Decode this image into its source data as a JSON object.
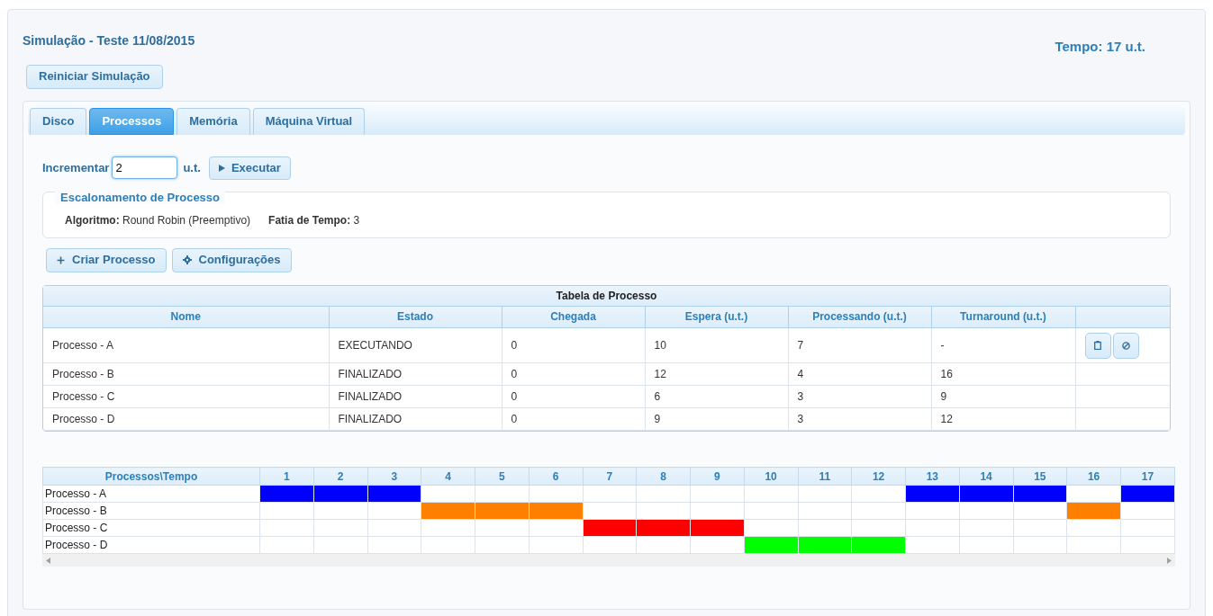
{
  "header": {
    "title": "Simulação - Teste 11/08/2015",
    "time": "Tempo: 17 u.t.",
    "restart_button": "Reiniciar Simulação"
  },
  "tabs": [
    {
      "label": "Disco",
      "selected": false
    },
    {
      "label": "Processos",
      "selected": true
    },
    {
      "label": "Memória",
      "selected": false
    },
    {
      "label": "Máquina Virtual",
      "selected": false
    }
  ],
  "increment": {
    "label": "Incrementar",
    "value": "2",
    "unit": "u.t.",
    "button": "Executar"
  },
  "scheduling": {
    "legend": "Escalonamento de Processo",
    "algorithm_label": "Algoritmo:",
    "algorithm": "Round Robin (Preemptivo)",
    "slice_label": "Fatia de Tempo:",
    "slice": "3"
  },
  "actions": [
    "Criar Processo",
    "Configurações"
  ],
  "process_table": {
    "title": "Tabela de Processo",
    "columns": [
      "Nome",
      "Estado",
      "Chegada",
      "Espera (u.t.)",
      "Processando (u.t.)",
      "Turnaround (u.t.)"
    ],
    "rows": [
      {
        "cells": [
          "Processo - A",
          "EXECUTANDO",
          "0",
          "10",
          "7",
          "-"
        ],
        "row_buttons": true
      },
      {
        "cells": [
          "Processo - B",
          "FINALIZADO",
          "0",
          "12",
          "4",
          "16"
        ],
        "row_buttons": false
      },
      {
        "cells": [
          "Processo - C",
          "FINALIZADO",
          "0",
          "6",
          "3",
          "9"
        ],
        "row_buttons": false
      },
      {
        "cells": [
          "Processo - D",
          "FINALIZADO",
          "0",
          "9",
          "3",
          "12"
        ],
        "row_buttons": false
      }
    ]
  },
  "gantt": {
    "corner": "Processos\\Tempo",
    "times": [
      "1",
      "2",
      "3",
      "4",
      "5",
      "6",
      "7",
      "8",
      "9",
      "10",
      "11",
      "12",
      "13",
      "14",
      "15",
      "16",
      "17"
    ],
    "rows": [
      {
        "name": "Processo - A",
        "color": "#0000ff",
        "active": [
          true,
          true,
          true,
          false,
          false,
          false,
          false,
          false,
          false,
          false,
          false,
          false,
          true,
          true,
          true,
          false,
          true
        ]
      },
      {
        "name": "Processo - B",
        "color": "#ff8000",
        "active": [
          false,
          false,
          false,
          true,
          true,
          true,
          false,
          false,
          false,
          false,
          false,
          false,
          false,
          false,
          false,
          true,
          false
        ]
      },
      {
        "name": "Processo - C",
        "color": "#ff0000",
        "active": [
          false,
          false,
          false,
          false,
          false,
          false,
          true,
          true,
          true,
          false,
          false,
          false,
          false,
          false,
          false,
          false,
          false
        ]
      },
      {
        "name": "Processo - D",
        "color": "#00ff00",
        "active": [
          false,
          false,
          false,
          false,
          false,
          false,
          false,
          false,
          false,
          true,
          true,
          true,
          false,
          false,
          false,
          false,
          false
        ]
      }
    ]
  }
}
